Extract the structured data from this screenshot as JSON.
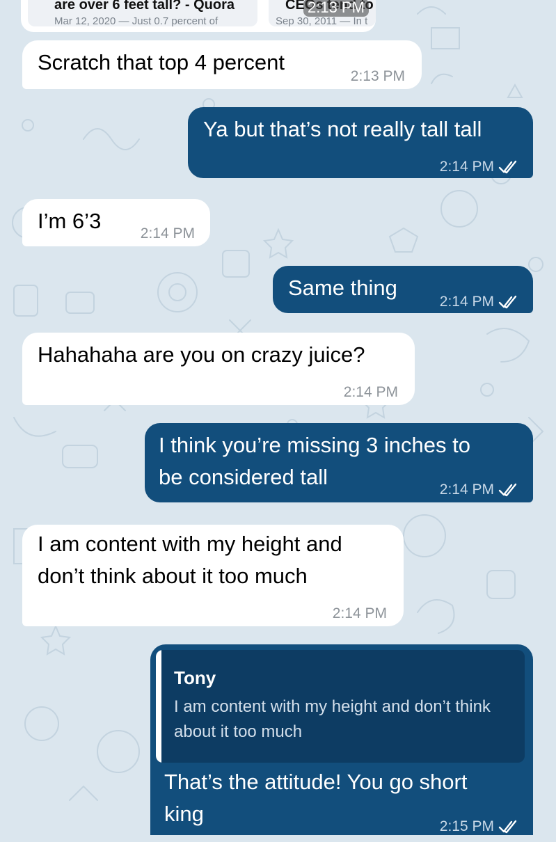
{
  "link_previews": [
    {
      "title": "are over 6 feet tall? - Quora",
      "date": "Mar 12, 2020 — Just 0.7 percent of"
    },
    {
      "title": "CEOs tend to b",
      "date": "Sep 30, 2011 — In t",
      "time": "2:13 PM"
    }
  ],
  "messages": [
    {
      "direction": "incoming",
      "text": "Scratch that top 4 percent",
      "time": "2:13 PM"
    },
    {
      "direction": "outgoing",
      "text": "Ya but that’s not really tall tall",
      "time": "2:14 PM",
      "status": "read"
    },
    {
      "direction": "incoming",
      "text": "I’m 6’3",
      "time": "2:14 PM"
    },
    {
      "direction": "outgoing",
      "text": "Same thing",
      "time": "2:14 PM",
      "status": "read"
    },
    {
      "direction": "incoming",
      "text": "Hahahaha are you on crazy juice?",
      "time": "2:14 PM"
    },
    {
      "direction": "outgoing",
      "lines": [
        "I think you’re missing 3 inches to",
        "be considered tall"
      ],
      "time": "2:14 PM",
      "status": "read"
    },
    {
      "direction": "incoming",
      "lines": [
        "I am content with my height and",
        "don’t think about it too much"
      ],
      "time": "2:14 PM"
    },
    {
      "direction": "outgoing",
      "reply_to": {
        "author": "Tony",
        "text": "I am content with my height and don’t think about it too much"
      },
      "lines": [
        "That’s the attitude! You go short",
        "king"
      ],
      "time": "2:15 PM",
      "status": "read"
    }
  ],
  "colors": {
    "incoming_bubble": "#ffffff",
    "outgoing_bubble": "#124e7c",
    "background": "#dbe6ee"
  },
  "icons": {
    "read_status": "double-check-icon"
  }
}
